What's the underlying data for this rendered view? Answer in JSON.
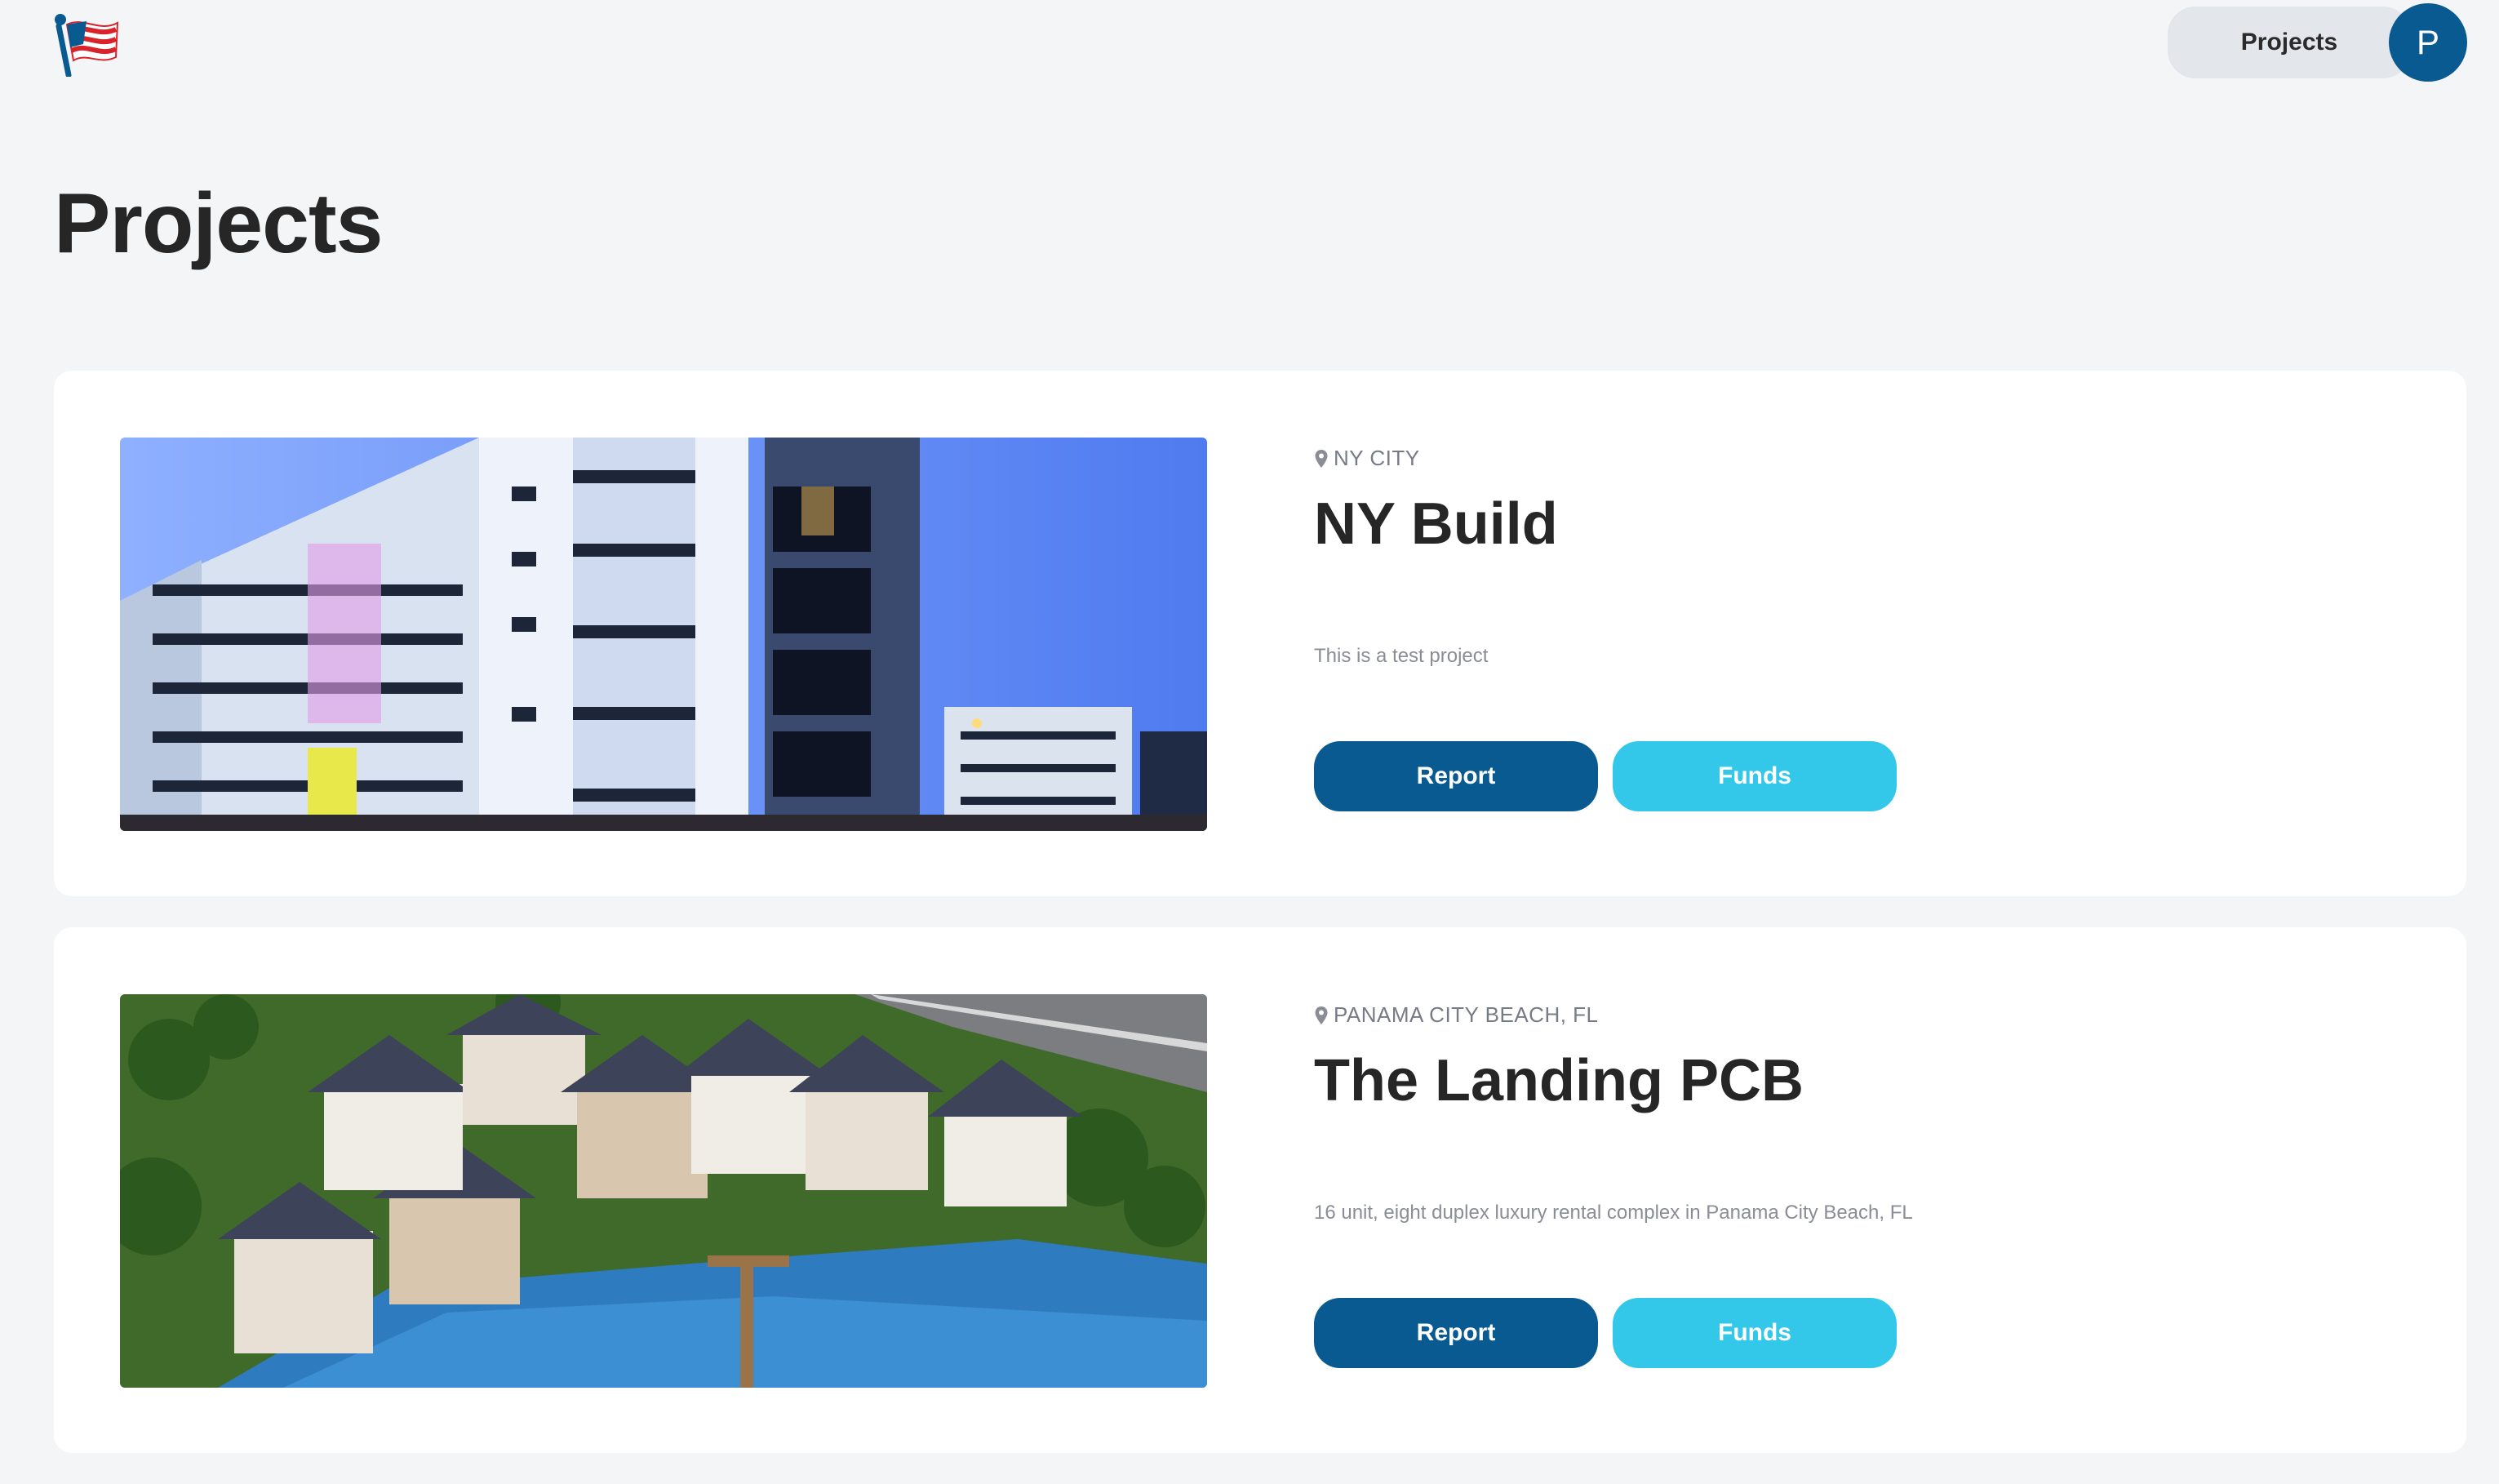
{
  "header": {
    "nav_projects_label": "Projects",
    "avatar_initial": "P"
  },
  "page": {
    "title": "Projects"
  },
  "projects": [
    {
      "location": "NY CITY",
      "title": "NY Build",
      "description": "This is a test project",
      "report_label": "Report",
      "funds_label": "Funds"
    },
    {
      "location": "PANAMA CITY BEACH, FL",
      "title": "The Landing PCB",
      "description": "16 unit, eight duplex luxury rental complex in Panama City Beach, FL",
      "report_label": "Report",
      "funds_label": "Funds"
    }
  ],
  "colors": {
    "primary": "#0a5a92",
    "accent": "#33c8ea",
    "background": "#f4f5f7"
  },
  "icons": {
    "logo": "flag-logo-icon",
    "location": "map-pin-icon"
  }
}
